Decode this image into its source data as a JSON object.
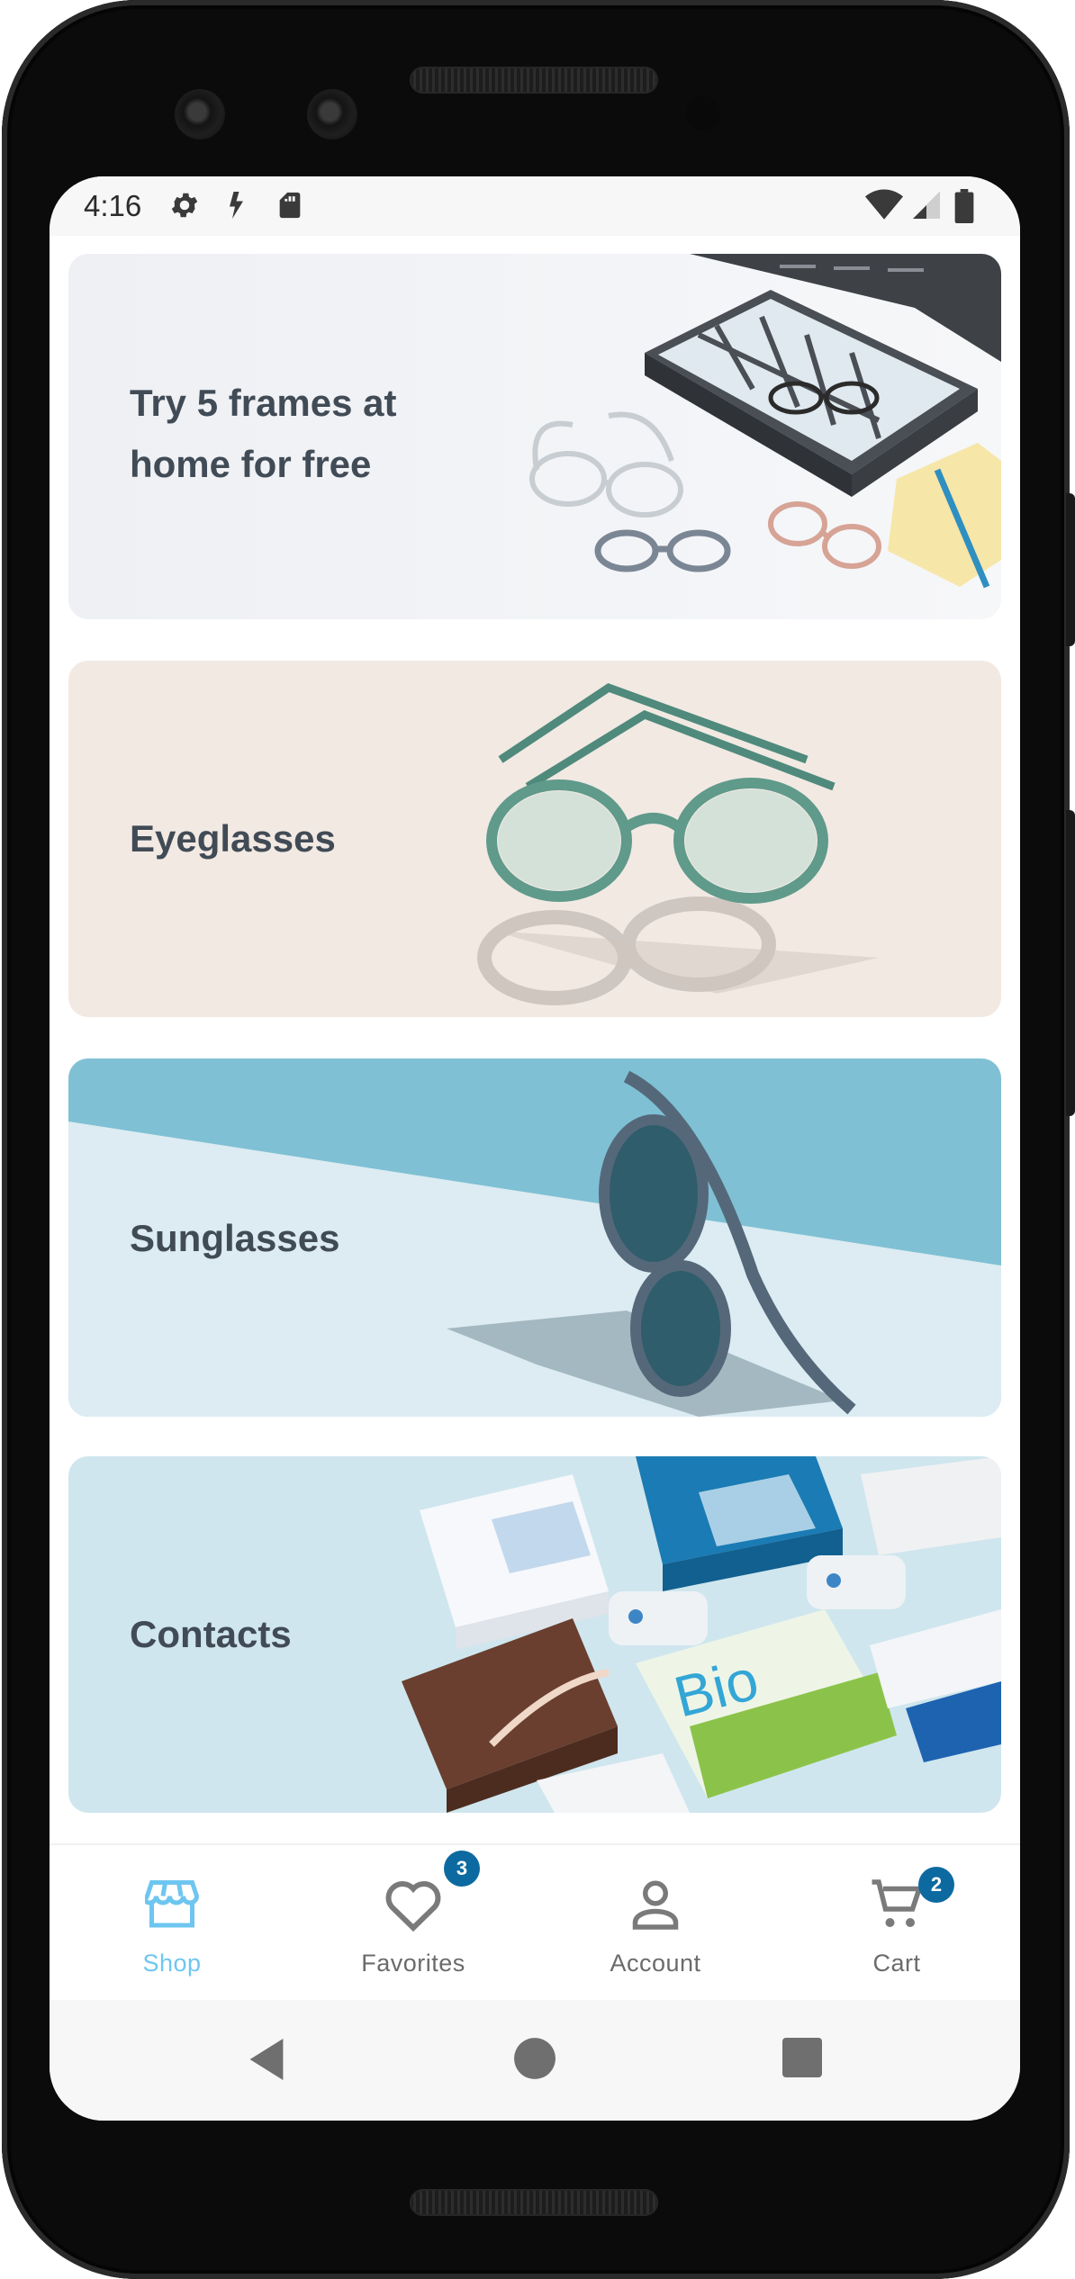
{
  "status_bar": {
    "time": "4:16",
    "left_icons": [
      "gear-icon",
      "assistant-icon",
      "sd-card-icon"
    ],
    "right_icons": [
      "wifi-icon",
      "signal-icon",
      "battery-icon"
    ]
  },
  "cards": [
    {
      "id": "home-try-on",
      "label_line1": "Try 5 frames at",
      "label_line2": "home for free",
      "bg": "#eef0f4"
    },
    {
      "id": "eyeglasses",
      "label": "Eyeglasses",
      "bg": "#f2e8e2"
    },
    {
      "id": "sunglasses",
      "label": "Sunglasses",
      "bg": "#7fc0d4"
    },
    {
      "id": "contacts",
      "label": "Contacts",
      "bg": "#cfe6ee"
    }
  ],
  "bottom_nav": {
    "items": [
      {
        "label": "Shop",
        "icon": "storefront-icon",
        "active": true
      },
      {
        "label": "Favorites",
        "icon": "heart-icon",
        "badge": "3"
      },
      {
        "label": "Account",
        "icon": "person-icon"
      },
      {
        "label": "Cart",
        "icon": "cart-icon",
        "badge": "2"
      }
    ]
  },
  "colors": {
    "accent": "#6ec6f0",
    "badge": "#0d6aa0",
    "label_text": "#414b56"
  },
  "system_nav": [
    "back-icon",
    "home-icon",
    "recents-icon"
  ]
}
